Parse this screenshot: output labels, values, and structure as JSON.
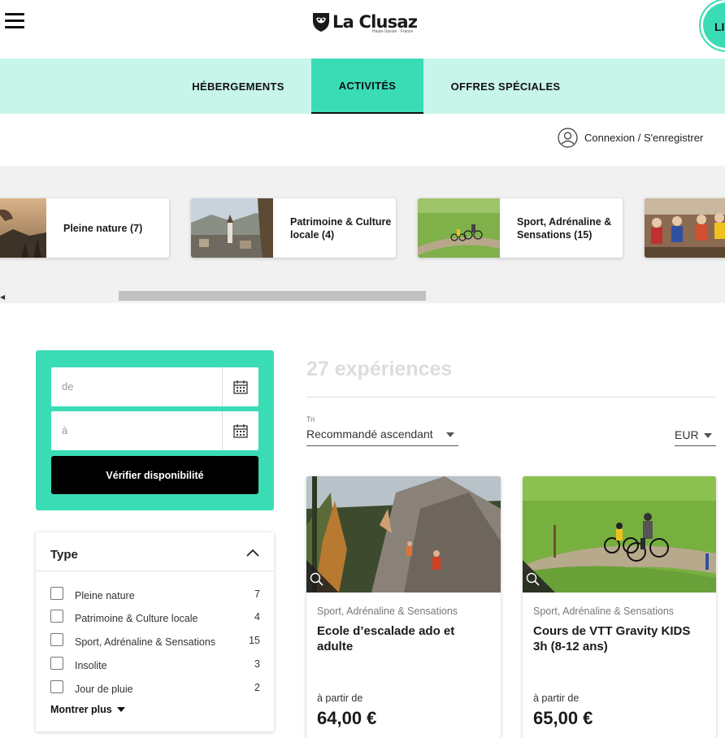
{
  "header": {
    "logo_text": "La Clusaz",
    "logo_subtitle": "Haute-Savoie · France",
    "live_button_label": "LIV"
  },
  "nav": {
    "tabs": [
      {
        "label": "HÉBERGEMENTS",
        "active": false
      },
      {
        "label": "ACTIVITÉS",
        "active": true
      },
      {
        "label": "OFFRES SPÉCIALES",
        "active": false
      }
    ]
  },
  "account": {
    "login_label": "Connexion / S'enregistrer"
  },
  "categories": [
    {
      "label": "Pleine nature (7)"
    },
    {
      "label": "Patrimoine & Culture locale (4)"
    },
    {
      "label": "Sport, Adrénaline & Sensations (15)"
    },
    {
      "label": ""
    }
  ],
  "availability": {
    "from_placeholder": "de",
    "to_placeholder": "à",
    "check_button": "Vérifier disponibilité"
  },
  "type_filter": {
    "title": "Type",
    "options": [
      {
        "label": "Pleine nature",
        "count": "7"
      },
      {
        "label": "Patrimoine & Culture locale",
        "count": "4"
      },
      {
        "label": "Sport, Adrénaline & Sensations",
        "count": "15"
      },
      {
        "label": "Insolite",
        "count": "3"
      },
      {
        "label": "Jour de pluie",
        "count": "2"
      }
    ],
    "show_more": "Montrer plus"
  },
  "results": {
    "count_label": "27 expériences",
    "sort_label": "Tri",
    "sort_value": "Recommandé ascendant",
    "currency": "EUR"
  },
  "experiences": [
    {
      "category": "Sport, Adrénaline & Sensations",
      "title": "Ecole d’escalade ado et adulte",
      "from_label": "à partir de",
      "price": "64,00 €"
    },
    {
      "category": "Sport, Adrénaline & Sensations",
      "title": "Cours de VTT Gravity KIDS 3h (8-12 ans)",
      "from_label": "à partir de",
      "price": "65,00 €"
    }
  ],
  "colors": {
    "accent": "#3adcb6",
    "nav_background": "#c8f5e9",
    "strip_background": "#f1f1f1"
  }
}
